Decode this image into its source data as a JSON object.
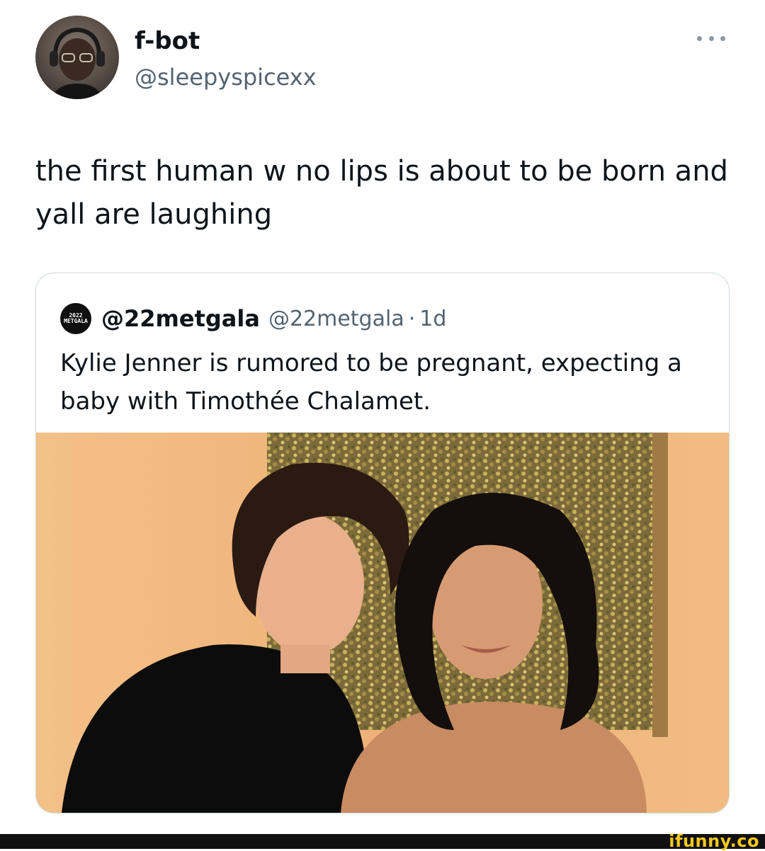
{
  "tweet": {
    "display_name": "f-bot",
    "handle": "@sleepyspicexx",
    "text": "the first human w no lips is about to be born and yall are laughing",
    "more_icon": "more-horizontal-icon"
  },
  "quoted_tweet": {
    "avatar_text_line1": "2022",
    "avatar_text_line2": "METGALA",
    "display_name": "@22metgala",
    "handle": "@22metgala",
    "separator": "·",
    "time": "1d",
    "text": "Kylie Jenner is rumored to be pregnant,  expecting a baby with Timothée Chalamet."
  },
  "footer": {
    "logo_text": "ifunny.co"
  },
  "colors": {
    "text_primary": "#0f1419",
    "text_secondary": "#536471",
    "border": "#cfd9de",
    "photo_background": "#f0b97a",
    "footer_bg": "#111111",
    "footer_logo": "#f3c81d"
  }
}
